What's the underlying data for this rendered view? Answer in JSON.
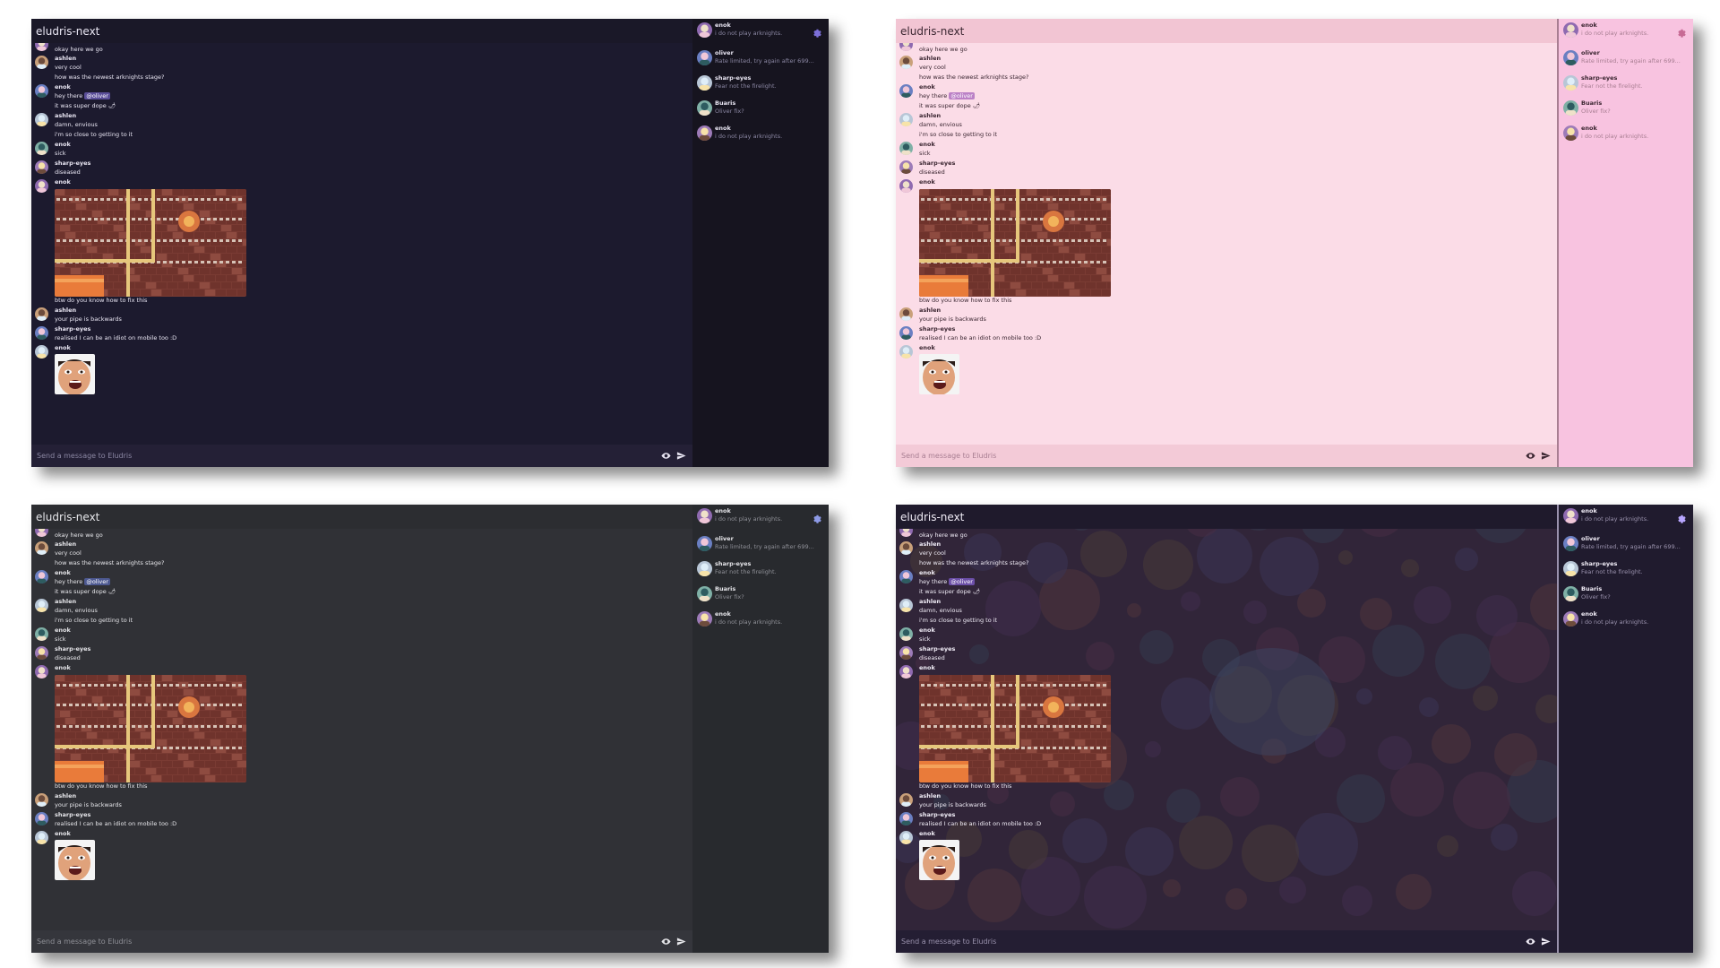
{
  "app_title": "eludris-next",
  "composer": {
    "placeholder": "Send a message to Eludris"
  },
  "icons": {
    "settings": "gear-icon",
    "preview": "eye-icon",
    "send": "send-icon"
  },
  "current_user": {
    "name": "enok",
    "status": "i do not play arknights."
  },
  "sidebar_users": [
    {
      "name": "oliver",
      "status": "Rate limited, try again after 699..."
    },
    {
      "name": "sharp-eyes",
      "status": "Fear not the firelight."
    },
    {
      "name": "Buaris",
      "status": "Oliver fix?"
    },
    {
      "name": "enok",
      "status": "i do not play arknights."
    }
  ],
  "messages": [
    {
      "type": "author",
      "text": "enok"
    },
    {
      "type": "text",
      "text": "okay here we go"
    },
    {
      "type": "author",
      "text": "ashlen"
    },
    {
      "type": "text",
      "text": "very cool"
    },
    {
      "type": "text",
      "text": "how was the newest arknights stage?"
    },
    {
      "type": "author",
      "text": "enok"
    },
    {
      "type": "mention",
      "before": "hey there",
      "mention": "@oliver"
    },
    {
      "type": "text",
      "text": "it was super dope 🌶"
    },
    {
      "type": "author",
      "text": "ashlen"
    },
    {
      "type": "text",
      "text": "damn, envious"
    },
    {
      "type": "text",
      "text": "i'm so close to getting to it"
    },
    {
      "type": "author",
      "text": "enok"
    },
    {
      "type": "text",
      "text": "sick"
    },
    {
      "type": "author",
      "text": "sharp-eyes"
    },
    {
      "type": "text",
      "text": "diseased"
    },
    {
      "type": "author",
      "text": "enok"
    },
    {
      "type": "image",
      "text": "pipe-puzzle-screenshot"
    },
    {
      "type": "text",
      "text": "btw do you know how to fix this"
    },
    {
      "type": "author",
      "text": "ashlen"
    },
    {
      "type": "text",
      "text": "your pipe is backwards"
    },
    {
      "type": "author",
      "text": "sharp-eyes"
    },
    {
      "type": "text",
      "text": "realised I can be an idiot on mobile too :D"
    },
    {
      "type": "author",
      "text": "enok"
    },
    {
      "type": "image",
      "text": "surprised-face-emote"
    }
  ],
  "themes": [
    {
      "name": "dark-purple",
      "panel": "#1c1a2e",
      "header": "#1a1828",
      "sidebar": "#16141f",
      "composer": "#242036",
      "text": "#e9e6f3",
      "muted": "#8b87a3",
      "accent": "#7c6fd8",
      "mention_bg": "#5a4e99",
      "bgart": false
    },
    {
      "name": "pink",
      "panel": "#fbdce7",
      "header": "#f2c5d3",
      "sidebar": "#f8c3e0",
      "composer": "#f3cad7",
      "text": "#3b2631",
      "muted": "#a87e92",
      "accent": "#c76b95",
      "mention_bg": "#bb81c6",
      "bgart": false
    },
    {
      "name": "dark-grey",
      "panel": "#303136",
      "header": "#2c2d31",
      "sidebar": "#282a2e",
      "composer": "#35363c",
      "text": "#e6e6ea",
      "muted": "#8f9097",
      "accent": "#8d9ae6",
      "mention_bg": "#4d5991",
      "bgart": false
    },
    {
      "name": "dark-art",
      "panel": "#2b2234",
      "header": "#1f1a2c",
      "sidebar": "#201b2e",
      "composer": "#241e33",
      "text": "#f0ecf6",
      "muted": "#9a92ad",
      "accent": "#b8a6ff",
      "mention_bg": "#6c4fa8",
      "bgart": true
    }
  ]
}
